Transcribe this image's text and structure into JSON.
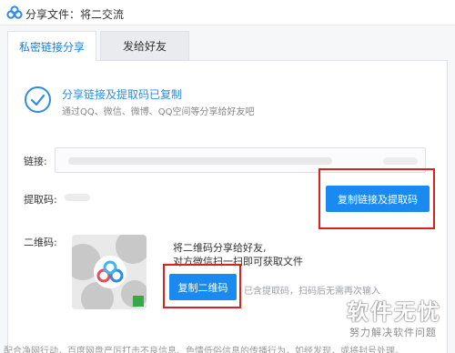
{
  "window": {
    "title": "分享文件：将二交流",
    "logo_icon": "baidu-netdisk-logo"
  },
  "tabs": [
    {
      "label": "私密链接分享",
      "active": true
    },
    {
      "label": "发给好友",
      "active": false
    }
  ],
  "success": {
    "icon": "check-circle-icon",
    "title": "分享链接及提取码已复制",
    "subtitle": "通过QQ、微信、微博、QQ空间等分享给好友吧"
  },
  "link": {
    "label": "链接:",
    "copy_button": "复制链接及提取码"
  },
  "code": {
    "label": "提取码:"
  },
  "qr": {
    "label": "二维码:",
    "hint_line1": "将二维码分享给好友,",
    "hint_line2": "对方微信扫一扫即可获取文件",
    "copy_button": "复制二维码",
    "note": "已含提取码，扫码后无需再次输入"
  },
  "footer": {
    "text": "配合净网行动，百度网盘严厉打击不良信息、色情低俗信息的传播行为，如经发现，或将封号处理。"
  },
  "watermark": {
    "main": "软件无忧",
    "sub": "努力解决软件问题"
  },
  "colors": {
    "accent": "#1a8af0",
    "highlight_frame": "#d9221f",
    "success_blue": "#2e8be6"
  }
}
